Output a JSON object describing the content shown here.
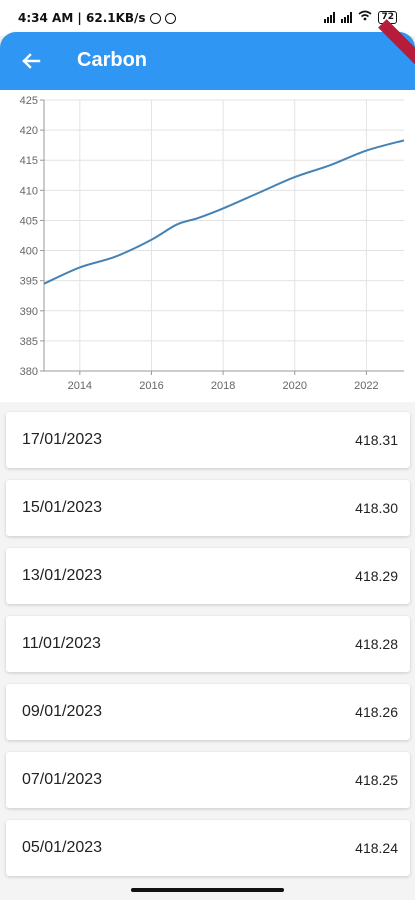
{
  "status_bar": {
    "left_text": "4:34 AM | 62.1KB/s",
    "battery": "72"
  },
  "app_bar": {
    "title": "Carbon",
    "back_icon": "arrow-left-icon"
  },
  "chart_data": {
    "type": "line",
    "title": "",
    "xlabel": "",
    "ylabel": "",
    "xlim": [
      2013.0,
      2023.05
    ],
    "ylim": [
      380,
      425
    ],
    "grid": true,
    "x_ticks": [
      "2014",
      "2016",
      "2018",
      "2020",
      "2022"
    ],
    "y_ticks": [
      "380",
      "385",
      "390",
      "395",
      "400",
      "405",
      "410",
      "415",
      "420",
      "425"
    ],
    "series": [
      {
        "color": "#4682b4",
        "x": [
          2013.0,
          2014.0,
          2015.0,
          2016.0,
          2016.7,
          2017.3,
          2018.0,
          2019.0,
          2020.0,
          2021.0,
          2022.0,
          2023.05
        ],
        "y": [
          394.5,
          397.2,
          399.0,
          401.8,
          404.3,
          405.4,
          407.0,
          409.6,
          412.2,
          414.2,
          416.6,
          418.3
        ]
      }
    ]
  },
  "readings": [
    {
      "date": "17/01/2023",
      "value": "418.31"
    },
    {
      "date": "15/01/2023",
      "value": "418.30"
    },
    {
      "date": "13/01/2023",
      "value": "418.29"
    },
    {
      "date": "11/01/2023",
      "value": "418.28"
    },
    {
      "date": "09/01/2023",
      "value": "418.26"
    },
    {
      "date": "07/01/2023",
      "value": "418.25"
    },
    {
      "date": "05/01/2023",
      "value": "418.24"
    }
  ]
}
